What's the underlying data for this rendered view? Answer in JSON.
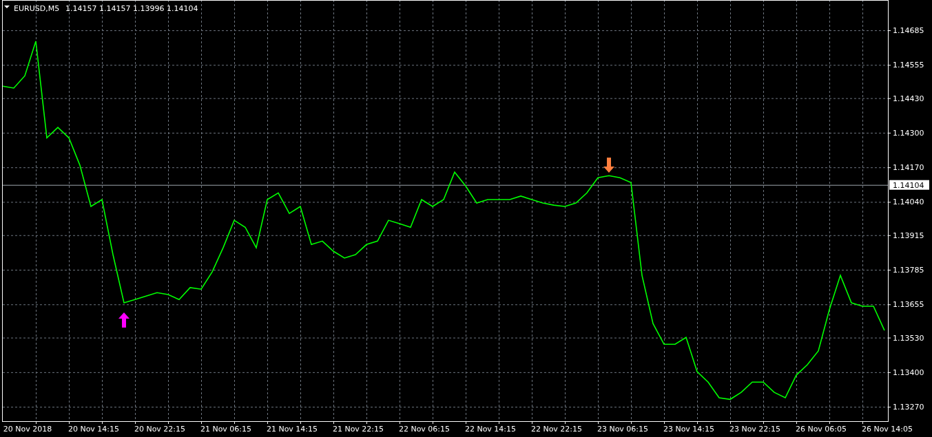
{
  "chart": {
    "symbol": "EURUSD,M5",
    "quotes": [
      "1.14157",
      "1.14157",
      "1.13996",
      "1.14104"
    ],
    "chart_data": {
      "type": "line",
      "categories": [
        null,
        null,
        "20 Nov 2018",
        null,
        null,
        null,
        null,
        null,
        "20 Nov 14:15",
        null,
        null,
        null,
        null,
        null,
        "20 Nov 22:15",
        null,
        null,
        null,
        null,
        null,
        "21 Nov 06:15",
        null,
        null,
        null,
        null,
        null,
        "21 Nov 14:15",
        null,
        null,
        null,
        null,
        null,
        "21 Nov 22:15",
        null,
        null,
        null,
        null,
        null,
        "22 Nov 06:15",
        null,
        null,
        null,
        null,
        null,
        "22 Nov 14:15",
        null,
        null,
        null,
        null,
        null,
        "22 Nov 22:15",
        null,
        null,
        null,
        null,
        null,
        "23 Nov 06:15",
        null,
        null,
        null,
        null,
        null,
        "23 Nov 14:15",
        null,
        null,
        null,
        null,
        null,
        "23 Nov 22:15",
        null,
        null,
        null,
        null,
        null,
        "26 Nov 06:05",
        null,
        null,
        null,
        null,
        null,
        "26 Nov 14:05"
      ],
      "series": [
        {
          "color": "#00ff00",
          "values": [
            1.14475,
            1.14468,
            1.14514,
            1.14644,
            1.14281,
            1.1432,
            1.14281,
            1.14178,
            1.14023,
            1.14049,
            1.13842,
            1.13661,
            1.13673,
            1.13686,
            1.13699,
            1.13692,
            1.13673,
            1.13718,
            1.13712,
            1.13777,
            1.13868,
            1.13971,
            1.13945,
            1.13868,
            1.14049,
            1.14074,
            1.13997,
            1.14023,
            1.1388,
            1.13893,
            1.13855,
            1.13829,
            1.13842,
            1.1388,
            1.13893,
            1.13971,
            1.13958,
            1.13945,
            1.14049,
            1.14023,
            1.14049,
            1.14152,
            1.141,
            1.14036,
            1.14049,
            1.14049,
            1.14049,
            1.14062,
            1.14049,
            1.14036,
            1.14028,
            1.14023,
            1.14036,
            1.14074,
            1.14131,
            1.14139,
            1.14131,
            1.14113,
            1.13764,
            1.13583,
            1.13505,
            1.13505,
            1.13531,
            1.13402,
            1.13363,
            1.13304,
            1.13298,
            1.13324,
            1.13363,
            1.13363,
            1.13324,
            1.13304,
            1.13389,
            1.13428,
            1.1348,
            1.13635,
            1.13764,
            1.13661,
            1.13648,
            1.13648,
            1.13557
          ]
        },
        {
          "color": "#ff00ff",
          "marker": "triangle",
          "values": [
            null,
            null,
            null,
            null,
            null,
            null,
            null,
            null,
            null,
            null,
            null,
            1.13596,
            null,
            null,
            null,
            null,
            null,
            null,
            null,
            null,
            null,
            null,
            null,
            null,
            null,
            null,
            null,
            null,
            null,
            null,
            null,
            null,
            null,
            null,
            null,
            null,
            null,
            null,
            null,
            null,
            null,
            null,
            null,
            null,
            null,
            null,
            null,
            null,
            null,
            null,
            null,
            null,
            null,
            null,
            null,
            null,
            null,
            null,
            null,
            null,
            null,
            null,
            null,
            null,
            null,
            null,
            null,
            null,
            null,
            null,
            null,
            null,
            null,
            null,
            null,
            null,
            null,
            null,
            null,
            null,
            null
          ]
        },
        {
          "color": "#ff7f3f",
          "marker": "triangle",
          "values": [
            null,
            null,
            null,
            null,
            null,
            null,
            null,
            null,
            null,
            null,
            null,
            null,
            null,
            null,
            null,
            null,
            null,
            null,
            null,
            null,
            null,
            null,
            null,
            null,
            null,
            null,
            null,
            null,
            null,
            null,
            null,
            null,
            null,
            null,
            null,
            null,
            null,
            null,
            null,
            null,
            null,
            null,
            null,
            null,
            null,
            null,
            null,
            null,
            null,
            null,
            null,
            null,
            null,
            null,
            null,
            1.14178,
            null,
            null,
            null,
            null,
            null,
            null,
            null,
            null,
            null,
            null,
            null,
            null,
            null,
            null,
            null,
            null,
            null,
            null,
            null,
            null,
            null,
            null,
            null,
            null,
            null
          ]
        }
      ],
      "ylim": [
        1.13216,
        1.14799
      ],
      "yticks": [
        {
          "value": 1.14685,
          "label": "1.14685"
        },
        {
          "value": 1.14555,
          "label": "1.14555"
        },
        {
          "value": 1.1443,
          "label": "1.14430"
        },
        {
          "value": 1.143,
          "label": "1.14300"
        },
        {
          "value": 1.1417,
          "label": "1.14170"
        },
        {
          "value": 1.1404,
          "label": "1.14040"
        },
        {
          "value": 1.13915,
          "label": "1.13915"
        },
        {
          "value": 1.13785,
          "label": "1.13785"
        },
        {
          "value": 1.13655,
          "label": "1.13655"
        },
        {
          "value": 1.1353,
          "label": "1.13530"
        },
        {
          "value": 1.134,
          "label": "1.13400"
        },
        {
          "value": 1.1327,
          "label": "1.13270"
        }
      ],
      "grid": true,
      "ref_lines": [
        {
          "axis": "y",
          "value": 1.14104,
          "label": "1.14104"
        }
      ]
    }
  }
}
